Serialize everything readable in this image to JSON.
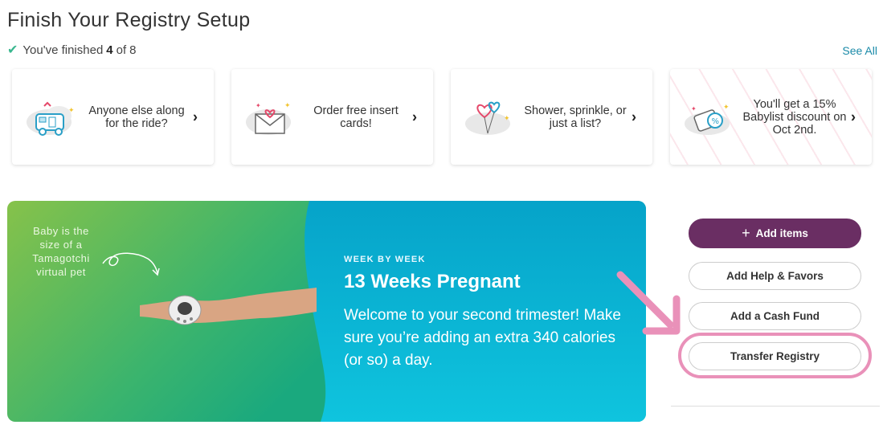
{
  "header": {
    "title": "Finish Your Registry Setup",
    "progress_prefix": "You've finished",
    "progress_done": "4",
    "progress_mid": "of",
    "progress_total": "8",
    "see_all": "See All"
  },
  "cards": [
    {
      "text": "Anyone else along for the ride?",
      "icon": "camper-icon"
    },
    {
      "text": "Order free insert cards!",
      "icon": "envelope-heart-icon"
    },
    {
      "text": "Shower, sprinkle, or just a list?",
      "icon": "balloons-icon"
    },
    {
      "text": "You'll get a 15% Babylist discount on Oct 2nd.",
      "icon": "discount-tag-icon"
    }
  ],
  "banner": {
    "baby_note": "Baby is the size of a Tamagotchi virtual pet",
    "week_label": "WEEK BY WEEK",
    "week_title": "13 Weeks Pregnant",
    "description": "Welcome to your second trimester! Make sure you’re adding an extra 340 calories (or so) a day."
  },
  "actions": {
    "add_items": "Add items",
    "add_help": "Add Help & Favors",
    "add_cash": "Add a Cash Fund",
    "transfer": "Transfer Registry"
  },
  "colors": {
    "primary": "#6a2e63",
    "check": "#3ab78f",
    "link": "#1a8aa8",
    "highlight": "#e991b9",
    "banner_blue": "#0fb4d6",
    "banner_green": "#3bb46d"
  }
}
